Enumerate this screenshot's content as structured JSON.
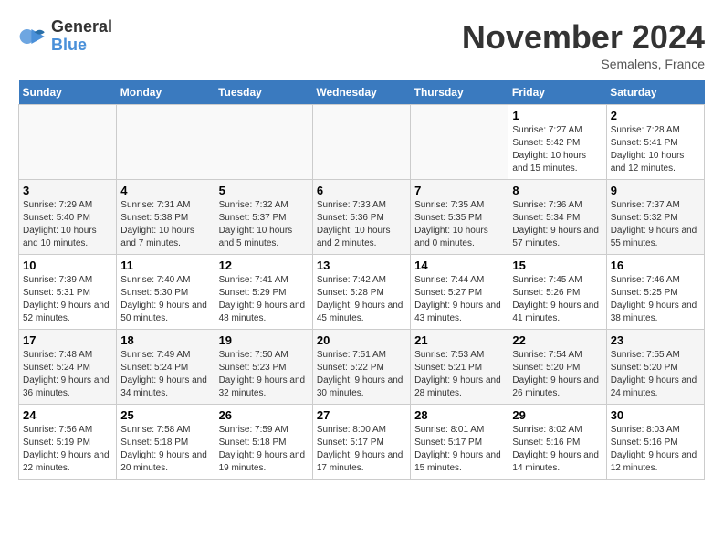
{
  "header": {
    "logo_line1": "General",
    "logo_line2": "Blue",
    "month": "November 2024",
    "location": "Semalens, France"
  },
  "weekdays": [
    "Sunday",
    "Monday",
    "Tuesday",
    "Wednesday",
    "Thursday",
    "Friday",
    "Saturday"
  ],
  "weeks": [
    [
      {
        "day": "",
        "info": ""
      },
      {
        "day": "",
        "info": ""
      },
      {
        "day": "",
        "info": ""
      },
      {
        "day": "",
        "info": ""
      },
      {
        "day": "",
        "info": ""
      },
      {
        "day": "1",
        "info": "Sunrise: 7:27 AM\nSunset: 5:42 PM\nDaylight: 10 hours and 15 minutes."
      },
      {
        "day": "2",
        "info": "Sunrise: 7:28 AM\nSunset: 5:41 PM\nDaylight: 10 hours and 12 minutes."
      }
    ],
    [
      {
        "day": "3",
        "info": "Sunrise: 7:29 AM\nSunset: 5:40 PM\nDaylight: 10 hours and 10 minutes."
      },
      {
        "day": "4",
        "info": "Sunrise: 7:31 AM\nSunset: 5:38 PM\nDaylight: 10 hours and 7 minutes."
      },
      {
        "day": "5",
        "info": "Sunrise: 7:32 AM\nSunset: 5:37 PM\nDaylight: 10 hours and 5 minutes."
      },
      {
        "day": "6",
        "info": "Sunrise: 7:33 AM\nSunset: 5:36 PM\nDaylight: 10 hours and 2 minutes."
      },
      {
        "day": "7",
        "info": "Sunrise: 7:35 AM\nSunset: 5:35 PM\nDaylight: 10 hours and 0 minutes."
      },
      {
        "day": "8",
        "info": "Sunrise: 7:36 AM\nSunset: 5:34 PM\nDaylight: 9 hours and 57 minutes."
      },
      {
        "day": "9",
        "info": "Sunrise: 7:37 AM\nSunset: 5:32 PM\nDaylight: 9 hours and 55 minutes."
      }
    ],
    [
      {
        "day": "10",
        "info": "Sunrise: 7:39 AM\nSunset: 5:31 PM\nDaylight: 9 hours and 52 minutes."
      },
      {
        "day": "11",
        "info": "Sunrise: 7:40 AM\nSunset: 5:30 PM\nDaylight: 9 hours and 50 minutes."
      },
      {
        "day": "12",
        "info": "Sunrise: 7:41 AM\nSunset: 5:29 PM\nDaylight: 9 hours and 48 minutes."
      },
      {
        "day": "13",
        "info": "Sunrise: 7:42 AM\nSunset: 5:28 PM\nDaylight: 9 hours and 45 minutes."
      },
      {
        "day": "14",
        "info": "Sunrise: 7:44 AM\nSunset: 5:27 PM\nDaylight: 9 hours and 43 minutes."
      },
      {
        "day": "15",
        "info": "Sunrise: 7:45 AM\nSunset: 5:26 PM\nDaylight: 9 hours and 41 minutes."
      },
      {
        "day": "16",
        "info": "Sunrise: 7:46 AM\nSunset: 5:25 PM\nDaylight: 9 hours and 38 minutes."
      }
    ],
    [
      {
        "day": "17",
        "info": "Sunrise: 7:48 AM\nSunset: 5:24 PM\nDaylight: 9 hours and 36 minutes."
      },
      {
        "day": "18",
        "info": "Sunrise: 7:49 AM\nSunset: 5:24 PM\nDaylight: 9 hours and 34 minutes."
      },
      {
        "day": "19",
        "info": "Sunrise: 7:50 AM\nSunset: 5:23 PM\nDaylight: 9 hours and 32 minutes."
      },
      {
        "day": "20",
        "info": "Sunrise: 7:51 AM\nSunset: 5:22 PM\nDaylight: 9 hours and 30 minutes."
      },
      {
        "day": "21",
        "info": "Sunrise: 7:53 AM\nSunset: 5:21 PM\nDaylight: 9 hours and 28 minutes."
      },
      {
        "day": "22",
        "info": "Sunrise: 7:54 AM\nSunset: 5:20 PM\nDaylight: 9 hours and 26 minutes."
      },
      {
        "day": "23",
        "info": "Sunrise: 7:55 AM\nSunset: 5:20 PM\nDaylight: 9 hours and 24 minutes."
      }
    ],
    [
      {
        "day": "24",
        "info": "Sunrise: 7:56 AM\nSunset: 5:19 PM\nDaylight: 9 hours and 22 minutes."
      },
      {
        "day": "25",
        "info": "Sunrise: 7:58 AM\nSunset: 5:18 PM\nDaylight: 9 hours and 20 minutes."
      },
      {
        "day": "26",
        "info": "Sunrise: 7:59 AM\nSunset: 5:18 PM\nDaylight: 9 hours and 19 minutes."
      },
      {
        "day": "27",
        "info": "Sunrise: 8:00 AM\nSunset: 5:17 PM\nDaylight: 9 hours and 17 minutes."
      },
      {
        "day": "28",
        "info": "Sunrise: 8:01 AM\nSunset: 5:17 PM\nDaylight: 9 hours and 15 minutes."
      },
      {
        "day": "29",
        "info": "Sunrise: 8:02 AM\nSunset: 5:16 PM\nDaylight: 9 hours and 14 minutes."
      },
      {
        "day": "30",
        "info": "Sunrise: 8:03 AM\nSunset: 5:16 PM\nDaylight: 9 hours and 12 minutes."
      }
    ]
  ]
}
